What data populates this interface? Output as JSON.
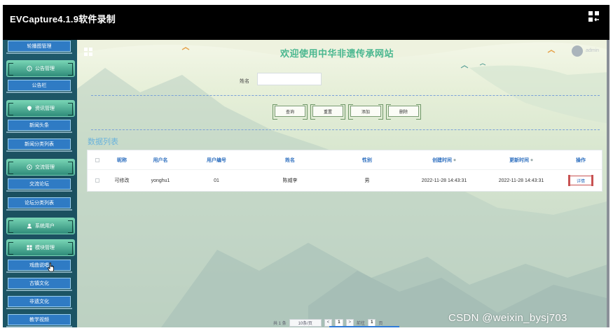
{
  "window": {
    "title": "EVCapture4.1.9软件录制"
  },
  "sidebar": {
    "items": [
      {
        "type": "sub",
        "label": "轮播图管理"
      },
      {
        "type": "top",
        "label": "公告管理",
        "icon": "info-icon"
      },
      {
        "type": "sub",
        "label": "公告栏"
      },
      {
        "type": "top",
        "label": "资讯管理",
        "icon": "location-pin-icon"
      },
      {
        "type": "sub",
        "label": "新闻头条"
      },
      {
        "type": "sub",
        "label": "新闻分类列表"
      },
      {
        "type": "top",
        "label": "交流管理",
        "icon": "chat-icon"
      },
      {
        "type": "sub",
        "label": "交流论坛"
      },
      {
        "type": "sub",
        "label": "论坛分类列表"
      },
      {
        "type": "top",
        "label": "系统用户",
        "icon": "user-icon"
      },
      {
        "type": "top",
        "label": "模块管理",
        "icon": "grid-icon"
      },
      {
        "type": "sub",
        "label": "戏曲说唱"
      },
      {
        "type": "sub",
        "label": "古镇文化"
      },
      {
        "type": "sub",
        "label": "非遗文化"
      },
      {
        "type": "sub",
        "label": "教学视频"
      }
    ]
  },
  "header": {
    "title": "欢迎使用中华非遗传承网站",
    "user": "admin"
  },
  "search": {
    "label": "姓名",
    "value": "",
    "placeholder": ""
  },
  "buttons": {
    "query": "查询",
    "reset": "重置",
    "add": "添加",
    "delete": "删除"
  },
  "list": {
    "title": "数据列表",
    "columns": [
      "昵称",
      "用户名",
      "用户编号",
      "姓名",
      "性别",
      "创建时间",
      "更新时间",
      "操作"
    ],
    "rows": [
      {
        "nickname": "可修改",
        "username": "yonghu1",
        "user_no": "01",
        "name": "陈威李",
        "gender": "男",
        "created": "2022-11-28 14:43:31",
        "updated": "2022-11-28 14:43:31",
        "action": "详情"
      }
    ]
  },
  "pager": {
    "total": "共 1 条",
    "page_size": "10条/页",
    "prev": "<",
    "current": "1",
    "next": ">",
    "goto_label": "前往",
    "goto_value": "1",
    "goto_suffix": "页"
  },
  "watermark": "CSDN @weixin_bysj703",
  "colors": {
    "title_green": "#49b78f",
    "sidebar_bg": "#1f5a6b",
    "sub_blue": "#2f7bc4",
    "header_blue": "#2e6fbf"
  }
}
